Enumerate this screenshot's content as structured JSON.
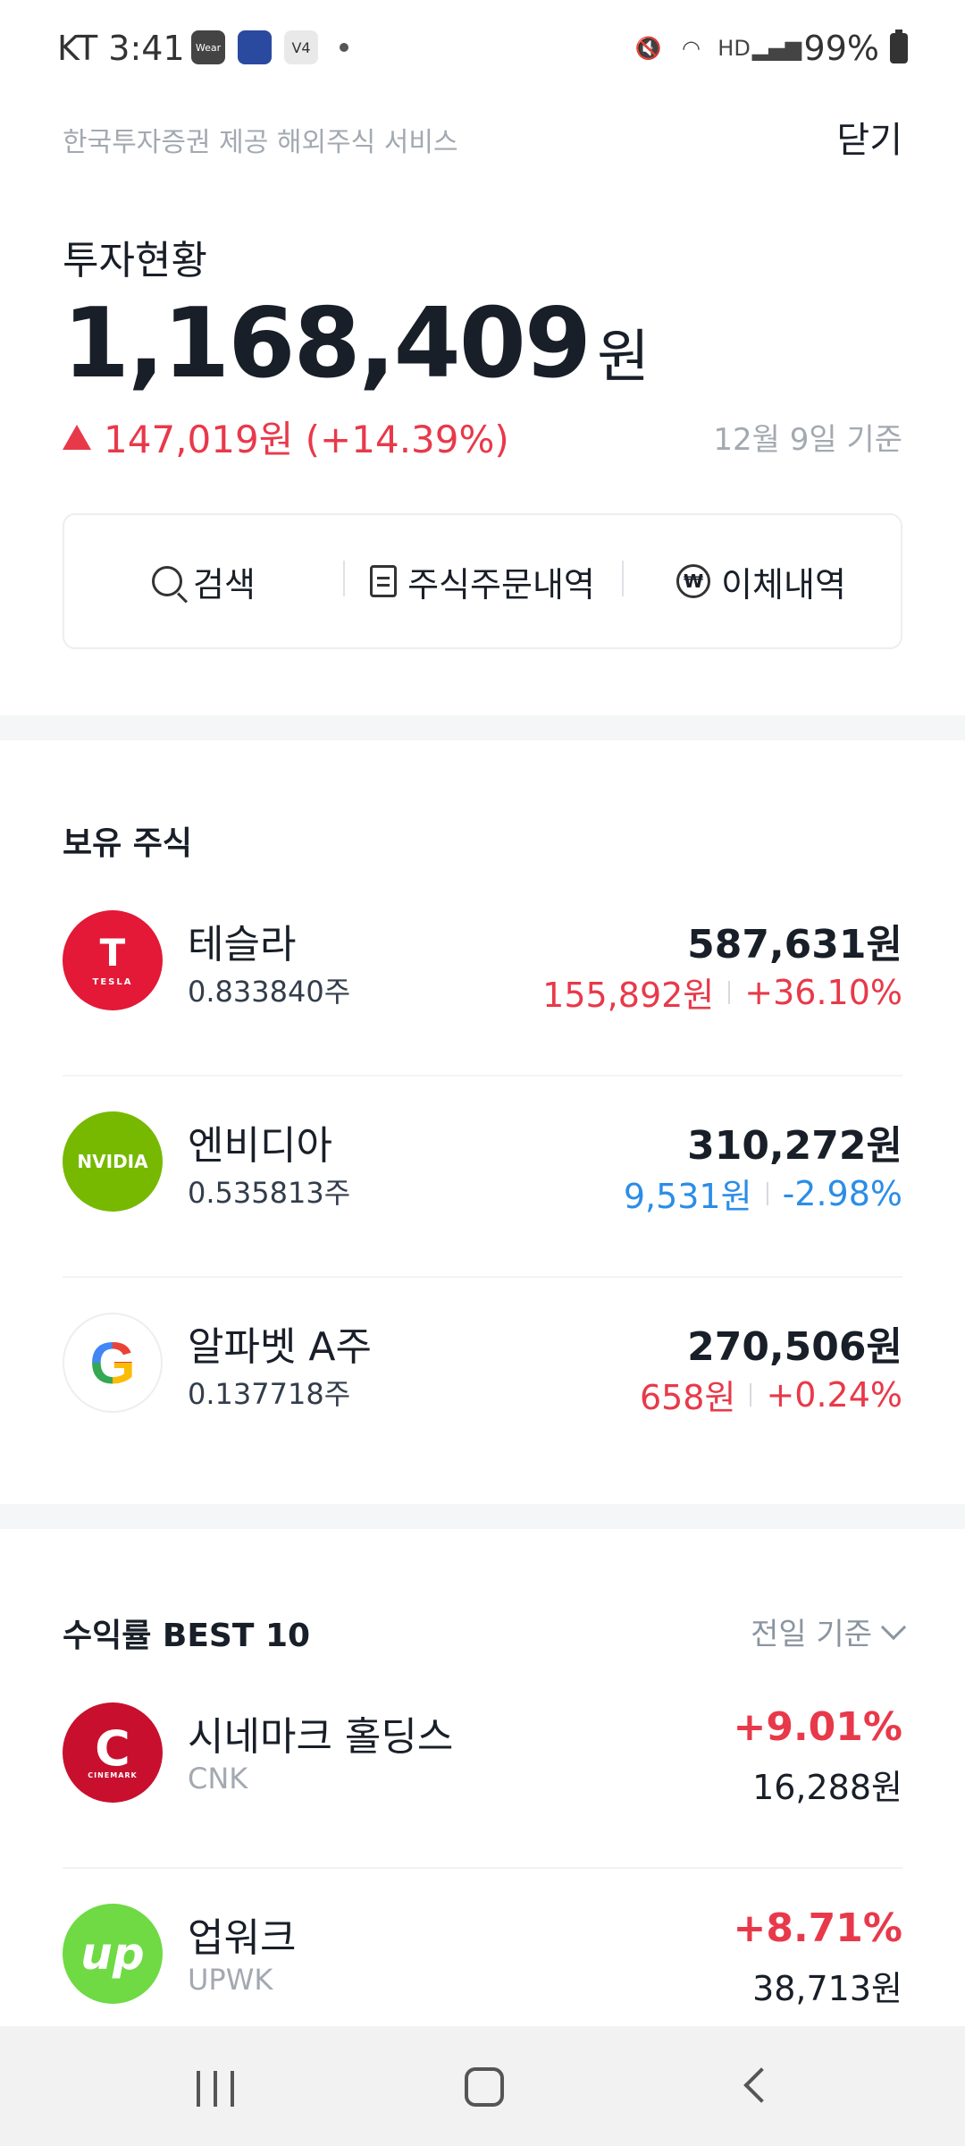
{
  "status_bar": {
    "carrier": "KT",
    "time": "3:41",
    "battery": "99%",
    "app_icons": [
      "Wear",
      "shinhan",
      "V4"
    ]
  },
  "header": {
    "provider": "한국투자증권 제공 해외주식 서비스",
    "close_label": "닫기"
  },
  "summary": {
    "title": "투자현황",
    "amount": "1,168,409",
    "unit": "원",
    "change": "147,019원 (+14.39%)",
    "as_of": "12월 9일 기준"
  },
  "actions": [
    {
      "label": "검색",
      "icon": "search-icon"
    },
    {
      "label": "주식주문내역",
      "icon": "document-icon"
    },
    {
      "label": "이체내역",
      "icon": "won-icon"
    }
  ],
  "holdings": {
    "title": "보유 주식",
    "items": [
      {
        "name": "테슬라",
        "shares": "0.833840주",
        "value": "587,631원",
        "profit": "155,892원",
        "rate": "+36.10%",
        "trend": "up",
        "logo_text": "T",
        "logo_sub": "TESLA",
        "logo_color": "#e31937"
      },
      {
        "name": "엔비디아",
        "shares": "0.535813주",
        "value": "310,272원",
        "profit": "9,531원",
        "rate": "-2.98%",
        "trend": "down",
        "logo_text": "NVIDIA",
        "logo_color": "#76b900"
      },
      {
        "name": "알파벳 A주",
        "shares": "0.137718주",
        "value": "270,506원",
        "profit": "658원",
        "rate": "+0.24%",
        "trend": "up",
        "logo_text": "G",
        "logo_color": "#ffffff"
      }
    ]
  },
  "best": {
    "title": "수익률 BEST 10",
    "filter": "전일 기준",
    "items": [
      {
        "name": "시네마크 홀딩스",
        "ticker": "CNK",
        "rate": "+9.01%",
        "price": "16,288원",
        "logo_text": "C",
        "logo_sub": "CINEMARK",
        "logo_color": "#c8102e"
      },
      {
        "name": "업워크",
        "ticker": "UPWK",
        "rate": "+8.71%",
        "price": "38,713원",
        "logo_text": "up",
        "logo_color": "#6fda44"
      }
    ]
  },
  "colors": {
    "up": "#e8394a",
    "down": "#2b8de8"
  }
}
